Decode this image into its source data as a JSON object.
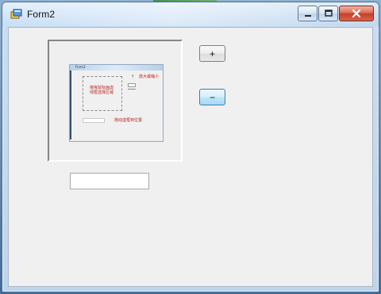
{
  "window": {
    "title": "Form2",
    "icon": "app-window-icon",
    "caption_icons": [
      "minimize-icon",
      "maximize-icon",
      "close-icon"
    ]
  },
  "main": {
    "preview": {
      "title": "Form2",
      "selection_text": "拖曳鼠标画虚\n线框选择区域",
      "right_arrow": "↑",
      "right_note": "放大或缩小",
      "bottom_note": "拖动虚框到位置"
    },
    "buttons": {
      "plus": "+",
      "minus": "−"
    },
    "input": {
      "value": "",
      "placeholder": ""
    }
  },
  "colors": {
    "accent_blue": "#3c7fb1",
    "note_red": "#b7221b",
    "client_bg": "#f0f0f0"
  }
}
